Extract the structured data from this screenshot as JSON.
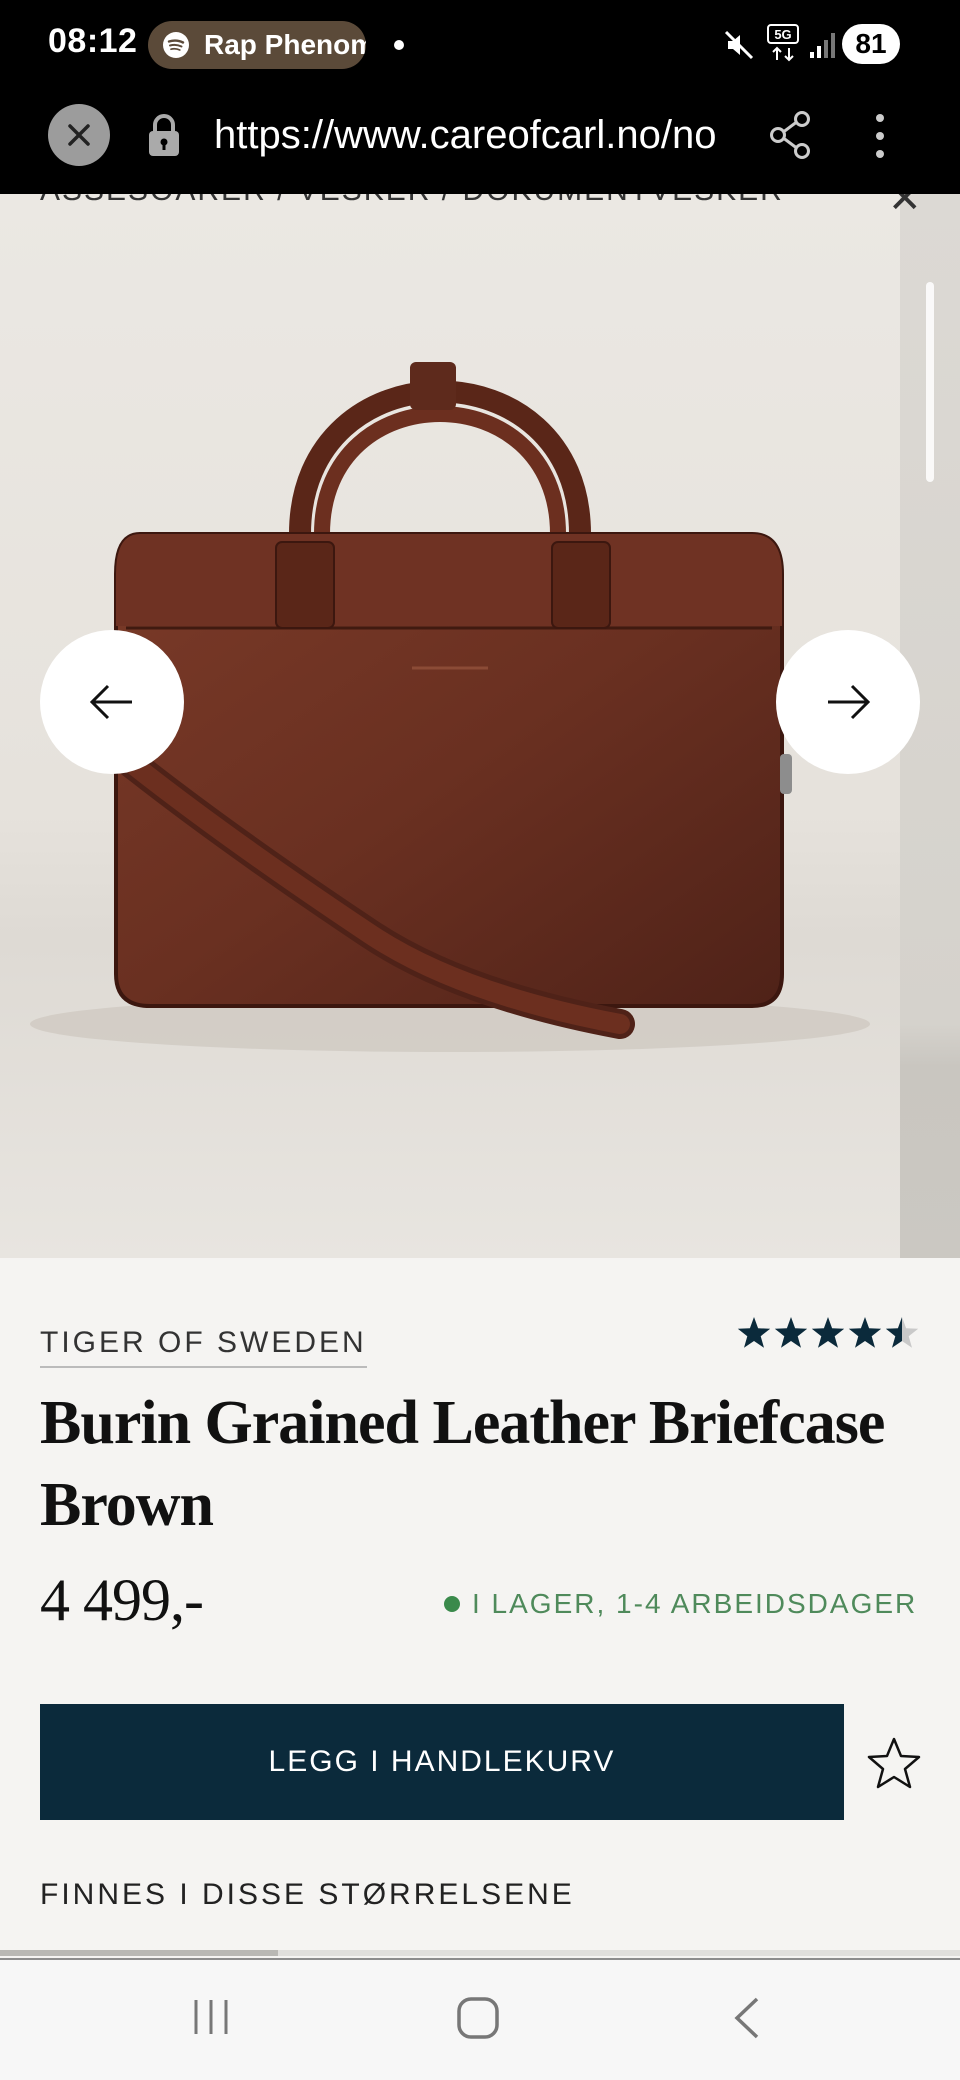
{
  "status_bar": {
    "time": "08:12",
    "spotify_text": "Rap Phenom",
    "network": "5G",
    "battery": "81"
  },
  "browser": {
    "url": "https://www.careofcarl.no/no"
  },
  "breadcrumb": "ASSESOARER / VESKER / DOKUMENTVESKER",
  "product": {
    "brand": "TIGER OF SWEDEN",
    "rating": 4.5,
    "rating_max": 5,
    "title": "Burin Grained Leather Briefcase Brown",
    "price": "4 499,-",
    "stock": "I LAGER, 1-4 ARBEIDSDAGER",
    "add_to_cart_label": "LEGG I HANDLEKURV",
    "sizes_heading": "FINNES I DISSE STØRRELSENE",
    "gallery_progress": 0.29
  },
  "colors": {
    "accent": "#0b2a3b",
    "stock_green": "#3a8a4b",
    "leather": "#6a3021"
  },
  "icons": {
    "close": "close-icon",
    "lock": "lock-icon",
    "share": "share-icon",
    "menu": "more-vertical-icon",
    "prev": "arrow-left-icon",
    "next": "arrow-right-icon",
    "favorite": "star-outline-icon",
    "nav_recents": "recents-icon",
    "nav_home": "home-icon",
    "nav_back": "back-icon"
  }
}
